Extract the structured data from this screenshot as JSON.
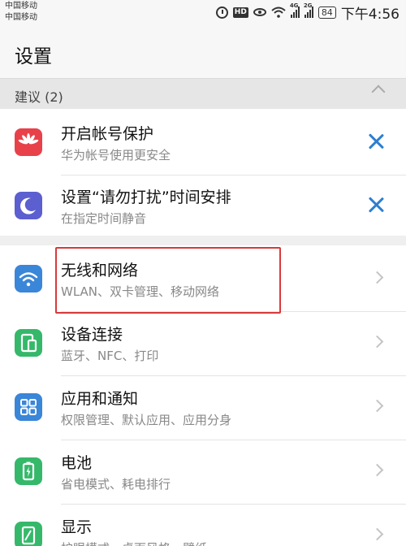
{
  "status_bar": {
    "carrier_1": "中国移动",
    "carrier_2": "中国移动",
    "hd_label": "HD",
    "network_1": "4G",
    "network_2": "2G",
    "battery": "84",
    "time": "下午4:56"
  },
  "header": {
    "title": "设置"
  },
  "suggestions": {
    "title": "建议 (2)",
    "items": [
      {
        "title": "开启帐号保护",
        "subtitle": "华为帐号使用更安全",
        "icon": "huawei-logo-icon",
        "icon_color": "#e8414a"
      },
      {
        "title": "设置“请勿打扰”时间安排",
        "subtitle": "在指定时间静音",
        "icon": "moon-icon",
        "icon_color": "#5b5fd0"
      }
    ]
  },
  "settings": {
    "items": [
      {
        "title": "无线和网络",
        "subtitle": "WLAN、双卡管理、移动网络",
        "icon": "wifi-icon",
        "icon_color": "#3a86d8"
      },
      {
        "title": "设备连接",
        "subtitle": "蓝牙、NFC、打印",
        "icon": "device-connection-icon",
        "icon_color": "#35b86a"
      },
      {
        "title": "应用和通知",
        "subtitle": "权限管理、默认应用、应用分身",
        "icon": "apps-grid-icon",
        "icon_color": "#3a86d8"
      },
      {
        "title": "电池",
        "subtitle": "省电模式、耗电排行",
        "icon": "battery-icon",
        "icon_color": "#35b86a"
      },
      {
        "title": "显示",
        "subtitle": "护眼模式、桌面风格、壁纸",
        "icon": "display-icon",
        "icon_color": "#35b86a"
      }
    ]
  },
  "colors": {
    "accent_blue": "#2d7fd0",
    "highlight_red": "#d83a3a"
  }
}
